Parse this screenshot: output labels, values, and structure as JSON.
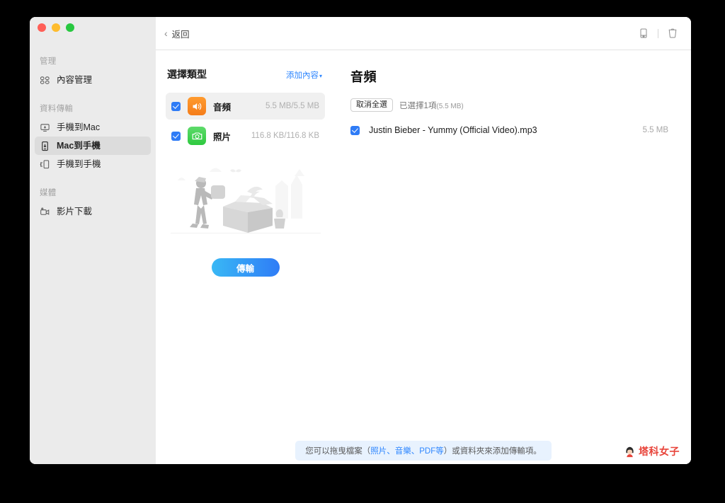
{
  "window": {
    "traffic_lights": [
      "close",
      "minimize",
      "zoom"
    ]
  },
  "sidebar": {
    "sections": [
      {
        "header": "管理",
        "items": [
          {
            "label": "內容管理",
            "icon": "grid-icon",
            "active": false
          }
        ]
      },
      {
        "header": "資料傳輸",
        "items": [
          {
            "label": "手機到Mac",
            "icon": "phone-to-mac-icon",
            "active": false
          },
          {
            "label": "Mac到手機",
            "icon": "mac-to-phone-icon",
            "active": true
          },
          {
            "label": "手機到手機",
            "icon": "phone-to-phone-icon",
            "active": false
          }
        ]
      },
      {
        "header": "媒體",
        "items": [
          {
            "label": "影片下載",
            "icon": "video-download-icon",
            "active": false
          }
        ]
      }
    ]
  },
  "toolbar": {
    "back_label": "返回",
    "back_chevron": "‹",
    "device_icon": "device-icon",
    "trash_icon": "trash-icon"
  },
  "types_panel": {
    "title": "選擇類型",
    "add_content_label": "添加內容",
    "add_content_caret": "▾",
    "rows": [
      {
        "name": "音頻",
        "size": "5.5 MB/5.5 MB",
        "icon": "speaker-icon",
        "checked": true,
        "selected": true
      },
      {
        "name": "照片",
        "size": "116.8 KB/116.8 KB",
        "icon": "camera-icon",
        "checked": true,
        "selected": false
      }
    ],
    "transfer_button_label": "傳輸"
  },
  "files_panel": {
    "title": "音頻",
    "deselect_all_label": "取消全選",
    "selection_count_text": "已選擇1項",
    "selection_size_text": "(5.5 MB)",
    "files": [
      {
        "name": "Justin Bieber - Yummy (Official Video).mp3",
        "size": "5.5 MB",
        "checked": true
      }
    ]
  },
  "bottom_bar": {
    "hint_prefix": "您可以拖曳檔案（",
    "hint_highlight": "照片、音樂、PDF等",
    "hint_suffix": "）或資料夾來添加傳輸項。"
  },
  "watermark": {
    "text": "塔科女子"
  },
  "colors": {
    "accent_blue": "#2f87ff",
    "checkbox_blue": "#2f7cf6",
    "audio_orange": "#f57d1a",
    "photo_green": "#2ec93f",
    "sidebar_bg": "#ebebeb",
    "watermark_red": "#e8443a",
    "hint_bg": "#e8f2fe"
  }
}
